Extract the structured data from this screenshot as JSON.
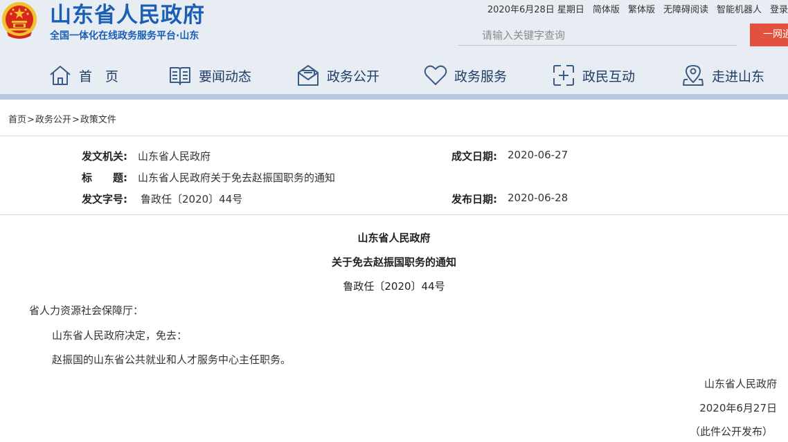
{
  "header": {
    "title": "山东省人民政府",
    "subtitle": "全国一体化在线政务服务平台·山东",
    "top_links": {
      "date": "2020年6月28日 星期日",
      "simplified": "简体版",
      "traditional": "繁体版",
      "accessible": "无障碍阅读",
      "robot": "智能机器人",
      "login": "登录"
    },
    "search": {
      "placeholder": "请输入关键字查询"
    },
    "onenet_label": "一网通"
  },
  "nav": {
    "items": [
      {
        "label": "首　页",
        "icon": "home-icon"
      },
      {
        "label": "要闻动态",
        "icon": "book-icon"
      },
      {
        "label": "政务公开",
        "icon": "envelope-icon"
      },
      {
        "label": "政务服务",
        "icon": "heart-icon"
      },
      {
        "label": "政民互动",
        "icon": "interact-icon"
      },
      {
        "label": "走进山东",
        "icon": "map-pin-icon"
      }
    ]
  },
  "breadcrumb": {
    "items": [
      "首页",
      "政务公开",
      "政策文件"
    ],
    "separator": ">"
  },
  "meta": {
    "issuer_label": "发文机关:",
    "issuer": "山东省人民政府",
    "created_label": "成文日期:",
    "created": "2020-06-27",
    "title_label": "标　　题:",
    "title": "山东省人民政府关于免去赵振国职务的通知",
    "doc_no_label": "发文字号:",
    "doc_no": "鲁政任〔2020〕44号",
    "published_label": "发布日期:",
    "published": "2020-06-28"
  },
  "document": {
    "heading1": "山东省人民政府",
    "heading2": "关于免去赵振国职务的通知",
    "doc_no": "鲁政任〔2020〕44号",
    "addressee": "省人力资源社会保障厅：",
    "para1": "山东省人民政府决定，免去：",
    "para2": "赵振国的山东省公共就业和人才服务中心主任职务。",
    "signature": "山东省人民政府",
    "date": "2020年6月27日",
    "note": "（此件公开发布）"
  },
  "colors": {
    "brand_blue": "#1a5fb4",
    "header_bg": "#e8edf4",
    "nav_bar": "#b8c9de",
    "onenet_red": "#e2513e",
    "emblem_red": "#d7261c",
    "emblem_gold": "#f2c230"
  }
}
